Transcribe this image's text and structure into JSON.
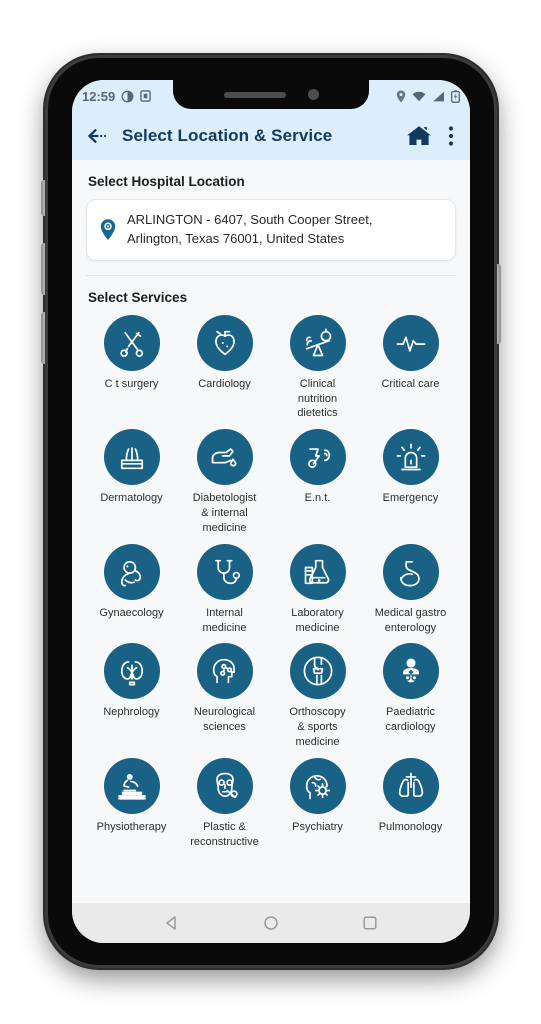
{
  "status_bar": {
    "time": "12:59",
    "left_icons": [
      "brightness-icon",
      "app-badge-icon"
    ],
    "right_icons": [
      "location-pin-icon",
      "wifi-icon",
      "signal-icon",
      "battery-icon"
    ]
  },
  "app_bar": {
    "back_label": "back-arrow",
    "title": "Select Location & Service",
    "home_label": "home",
    "menu_label": "more-options"
  },
  "location_section": {
    "title": "Select Hospital Location",
    "address_line1": "ARLINGTON - 6407, South Cooper Street,",
    "address_line2": "Arlington, Texas 76001, United States"
  },
  "services_section": {
    "title": "Select Services",
    "items": [
      {
        "label": "C t surgery",
        "icon": "surgery-tools-icon"
      },
      {
        "label": "Cardiology",
        "icon": "heart-icon"
      },
      {
        "label": "Clinical\nnutrition\ndietetics",
        "icon": "nutrition-scale-icon"
      },
      {
        "label": "Critical care",
        "icon": "heartbeat-line-icon"
      },
      {
        "label": "Dermatology",
        "icon": "skin-hair-icon"
      },
      {
        "label": "Diabetologist\n& internal\nmedicine",
        "icon": "finger-blood-drop-icon"
      },
      {
        "label": "E.n.t.",
        "icon": "ear-nose-throat-icon"
      },
      {
        "label": "Emergency",
        "icon": "siren-icon"
      },
      {
        "label": "Gynaecology",
        "icon": "fetus-icon"
      },
      {
        "label": "Internal\nmedicine",
        "icon": "stethoscope-icon"
      },
      {
        "label": "Laboratory\nmedicine",
        "icon": "lab-flask-icon"
      },
      {
        "label": "Medical gastro\nenterology",
        "icon": "stomach-icon"
      },
      {
        "label": "Nephrology",
        "icon": "kidney-icon"
      },
      {
        "label": "Neurological\nsciences",
        "icon": "brain-head-icon"
      },
      {
        "label": "Orthoscopy\n& sports\nmedicine",
        "icon": "knee-joint-icon"
      },
      {
        "label": "Paediatric\ncardiology",
        "icon": "baby-icon"
      },
      {
        "label": "Physiotherapy",
        "icon": "massage-therapy-icon"
      },
      {
        "label": "Plastic &\nreconstructive",
        "icon": "face-surgery-icon"
      },
      {
        "label": "Psychiatry",
        "icon": "brain-gear-icon"
      },
      {
        "label": "Pulmonology",
        "icon": "lungs-icon"
      }
    ]
  },
  "nav_bar": {
    "back": "back-triangle",
    "home": "home-circle",
    "recents": "recents-square"
  },
  "colors": {
    "accent_circle": "#1a6186",
    "app_bar_bg": "#dceefc",
    "title_text": "#123a5e",
    "screen_bg": "#f7f8f9"
  }
}
